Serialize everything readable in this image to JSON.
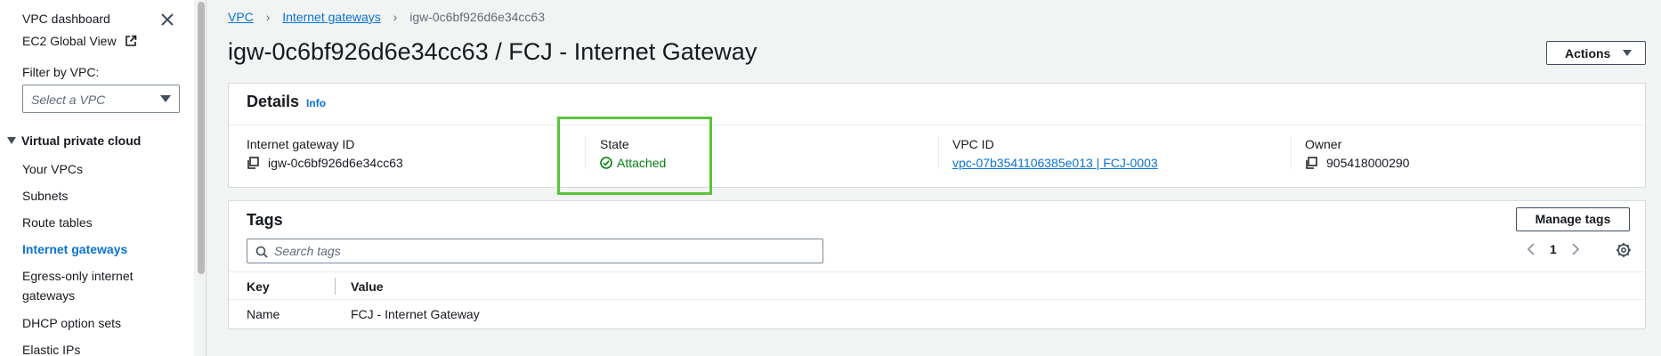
{
  "sidebar": {
    "vpc_dashboard": "VPC dashboard",
    "ec2_global_view": "EC2 Global View",
    "filter_label": "Filter by VPC:",
    "select_placeholder": "Select a VPC",
    "section_title": "Virtual private cloud",
    "items": [
      {
        "label": "Your VPCs",
        "active": false
      },
      {
        "label": "Subnets",
        "active": false
      },
      {
        "label": "Route tables",
        "active": false
      },
      {
        "label": "Internet gateways",
        "active": true
      },
      {
        "label": "Egress-only internet gateways",
        "active": false
      },
      {
        "label": "DHCP option sets",
        "active": false
      },
      {
        "label": "Elastic IPs",
        "active": false
      }
    ]
  },
  "breadcrumb": {
    "root": "VPC",
    "parent": "Internet gateways",
    "current": "igw-0c6bf926d6e34cc63"
  },
  "page": {
    "title": "igw-0c6bf926d6e34cc63 / FCJ - Internet Gateway",
    "actions_label": "Actions"
  },
  "details": {
    "header": "Details",
    "info_link": "Info",
    "fields": {
      "igw_id_label": "Internet gateway ID",
      "igw_id_value": "igw-0c6bf926d6e34cc63",
      "state_label": "State",
      "state_value": "Attached",
      "vpc_id_label": "VPC ID",
      "vpc_id_value": "vpc-07b3541106385e013 | FCJ-0003",
      "owner_label": "Owner",
      "owner_value": "905418000290"
    }
  },
  "tags": {
    "title": "Tags",
    "manage_label": "Manage tags",
    "search_placeholder": "Search tags",
    "page_number": "1",
    "columns": {
      "key": "Key",
      "value": "Value"
    },
    "rows": [
      {
        "key": "Name",
        "value": "FCJ - Internet Gateway"
      }
    ]
  },
  "colors": {
    "link": "#0972d3",
    "success": "#037f0c",
    "highlight": "#5ac43a"
  }
}
